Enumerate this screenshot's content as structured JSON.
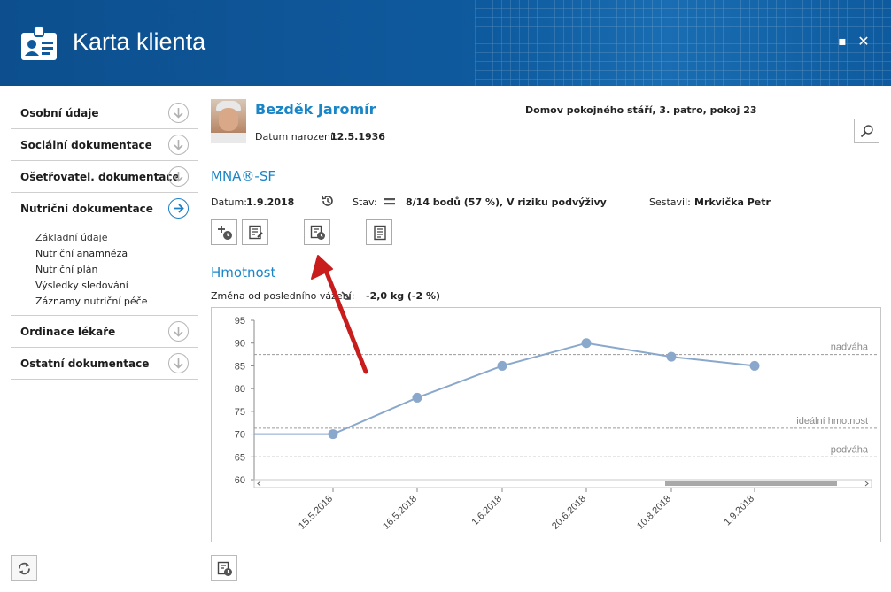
{
  "window": {
    "title": "Karta klienta",
    "maximize_glyph": "▪",
    "close_glyph": "✕"
  },
  "sidebar": {
    "items": [
      {
        "label": "Osobní údaje",
        "icon": "arrow-down-circle-icon",
        "active": false
      },
      {
        "label": "Sociální dokumentace",
        "icon": "arrow-down-circle-icon",
        "active": false
      },
      {
        "label": "Ošetřovatel. dokumentace",
        "icon": "arrow-down-circle-icon",
        "active": false
      },
      {
        "label": "Nutriční dokumentace",
        "icon": "arrow-right-circle-icon",
        "active": true
      },
      {
        "label": "Ordinace lékaře",
        "icon": "arrow-down-circle-icon",
        "active": false
      },
      {
        "label": "Ostatní dokumentace",
        "icon": "arrow-down-circle-icon",
        "active": false
      }
    ],
    "submenu": [
      {
        "label": "Základní údaje",
        "selected": true
      },
      {
        "label": "Nutriční anamnéza",
        "selected": false
      },
      {
        "label": "Nutriční plán",
        "selected": false
      },
      {
        "label": "Výsledky sledování",
        "selected": false
      },
      {
        "label": "Záznamy nutriční péče",
        "selected": false
      }
    ]
  },
  "patient": {
    "name": "Bezděk Jaromír",
    "dob_label": "Datum narození:",
    "dob_value": "12.5.1936",
    "location": "Domov pokojného stáří, 3. patro, pokoj 23"
  },
  "mna": {
    "title": "MNA®-SF",
    "date_label": "Datum:",
    "date_value": "1.9.2018",
    "status_label": "Stav:",
    "status_value": "8/14 bodů (57 %), V riziku podvýživy",
    "author_label": "Sestavil:",
    "author_value": "Mrkvička Petr"
  },
  "weight": {
    "title": "Hmotnost",
    "change_label": "Změna od posledního vážení:",
    "change_value": "-2,0 kg (-2 %)"
  },
  "colors": {
    "accent": "#1a86c8",
    "header": "#0e5a9e",
    "series": "#8aa8cc",
    "annotation_arrow": "#cc1f1f"
  },
  "chart_data": {
    "type": "line",
    "x": [
      "15.5.2018",
      "16.5.2018",
      "1.6.2018",
      "20.6.2018",
      "10.8.2018",
      "1.9.2018"
    ],
    "values": [
      70,
      78,
      85,
      90,
      87,
      85
    ],
    "ylim": [
      60,
      95
    ],
    "yticks": [
      95,
      90,
      85,
      80,
      75,
      70,
      65,
      60
    ],
    "reference_lines": [
      {
        "label": "nadváha",
        "value": 87.5
      },
      {
        "label": "ideální hmotnost",
        "value": 71.3
      },
      {
        "label": "podváha",
        "value": 65
      }
    ],
    "grid": false
  }
}
